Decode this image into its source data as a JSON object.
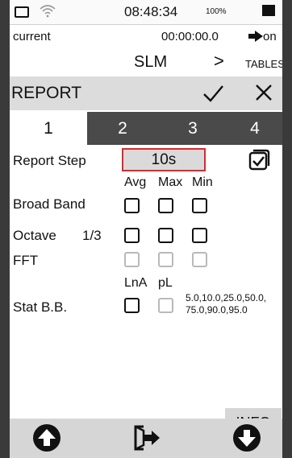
{
  "status_bar": {
    "clock": "08:48:34",
    "battery_percent": "100%",
    "icons": [
      "battery-outline-icon",
      "wifi-icon",
      "battery-full-icon"
    ]
  },
  "info_row": {
    "mode": "current",
    "timer": "00:00:00.0",
    "arrow_icon": "arrow-right-icon",
    "state": "on"
  },
  "nav_row": {
    "title": "SLM",
    "chevron": ">",
    "tables": "TABLES"
  },
  "header": {
    "title": "REPORT",
    "confirm_icon": "checkmark-icon",
    "close_icon": "close-icon"
  },
  "tabs": [
    {
      "label": "1",
      "active": true
    },
    {
      "label": "2",
      "active": false
    },
    {
      "label": "3",
      "active": false
    },
    {
      "label": "4",
      "active": false
    }
  ],
  "form": {
    "report_step_label": "Report Step",
    "report_step_value": "10s",
    "report_step_enabled": true,
    "columns": {
      "avg": "Avg",
      "max": "Max",
      "min": "Min"
    },
    "broad_band_label": "Broad Band",
    "octave_label": "Octave",
    "octave_fraction": "1/3",
    "fft_label": "FFT",
    "stat_label": "Stat B.B.",
    "stat_columns": {
      "lna": "LnA",
      "pl": "pL"
    },
    "stat_values_line1": "5.0,10.0,25.0,50.0,",
    "stat_values_line2": "75.0,90.0,95.0"
  },
  "info_button": "INFO",
  "bottom_bar": {
    "icons": [
      "arrow-up-circle-icon",
      "exit-icon",
      "arrow-down-circle-icon"
    ]
  },
  "colors": {
    "highlight_border": "#e1262a",
    "tab_bar": "#4a4a4a",
    "header_bg": "#dcdcdc"
  }
}
